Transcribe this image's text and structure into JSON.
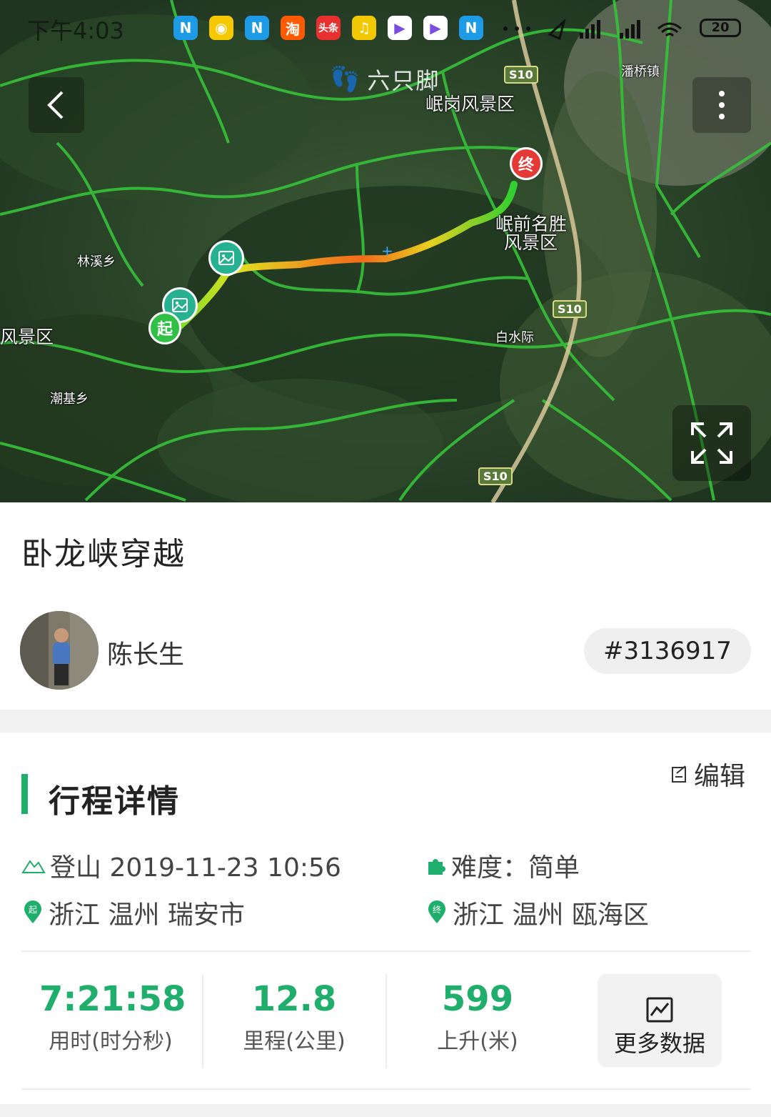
{
  "status_bar": {
    "time": "下午4:03",
    "battery": "20",
    "app_icons": [
      {
        "icon": "n-app-icon",
        "text": "N",
        "color": "#1e9be6"
      },
      {
        "icon": "car-app-icon",
        "text": "◉",
        "color": "#f5c800"
      },
      {
        "icon": "n-app-icon",
        "text": "N",
        "color": "#1e9be6"
      },
      {
        "icon": "taobao-icon",
        "text": "淘",
        "color": "#ff5a00"
      },
      {
        "icon": "toutiao-icon",
        "text": "头条",
        "color": "#e8312f"
      },
      {
        "icon": "music-icon",
        "text": "♫",
        "color": "#f2c800"
      },
      {
        "icon": "video-icon",
        "text": "▶",
        "color": "#ffffff"
      },
      {
        "icon": "video-icon",
        "text": "▶",
        "color": "#ffffff"
      },
      {
        "icon": "n-app-icon",
        "text": "N",
        "color": "#1e9be6"
      }
    ]
  },
  "map": {
    "watermark": "六只脚",
    "labels": [
      "岷岗风景区",
      "潘桥镇",
      "林溪乡",
      "风景区",
      "岷前名胜",
      "风景区",
      "白水际",
      "潮基乡"
    ],
    "road_shields": [
      "S10",
      "S10",
      "S10"
    ],
    "start_marker": "起",
    "end_marker": "终"
  },
  "route": {
    "title": "卧龙峡穿越",
    "author": "陈长生",
    "id": "#3136917"
  },
  "details": {
    "section_title": "行程详情",
    "edit_label": "编辑",
    "activity": "登山 2019-11-23 10:56",
    "difficulty": "难度：简单",
    "start_location": "浙江 温州 瑞安市",
    "end_location": "浙江 温州 瓯海区",
    "start_badge": "起",
    "end_badge": "终"
  },
  "stats": [
    {
      "value": "7:21:58",
      "label": "用时(时分秒)"
    },
    {
      "value": "12.8",
      "label": "里程(公里)"
    },
    {
      "value": "599",
      "label": "上升(米)"
    }
  ],
  "more_data_label": "更多数据",
  "colors": {
    "accent": "#1fae6b",
    "end_marker": "#e53935"
  }
}
